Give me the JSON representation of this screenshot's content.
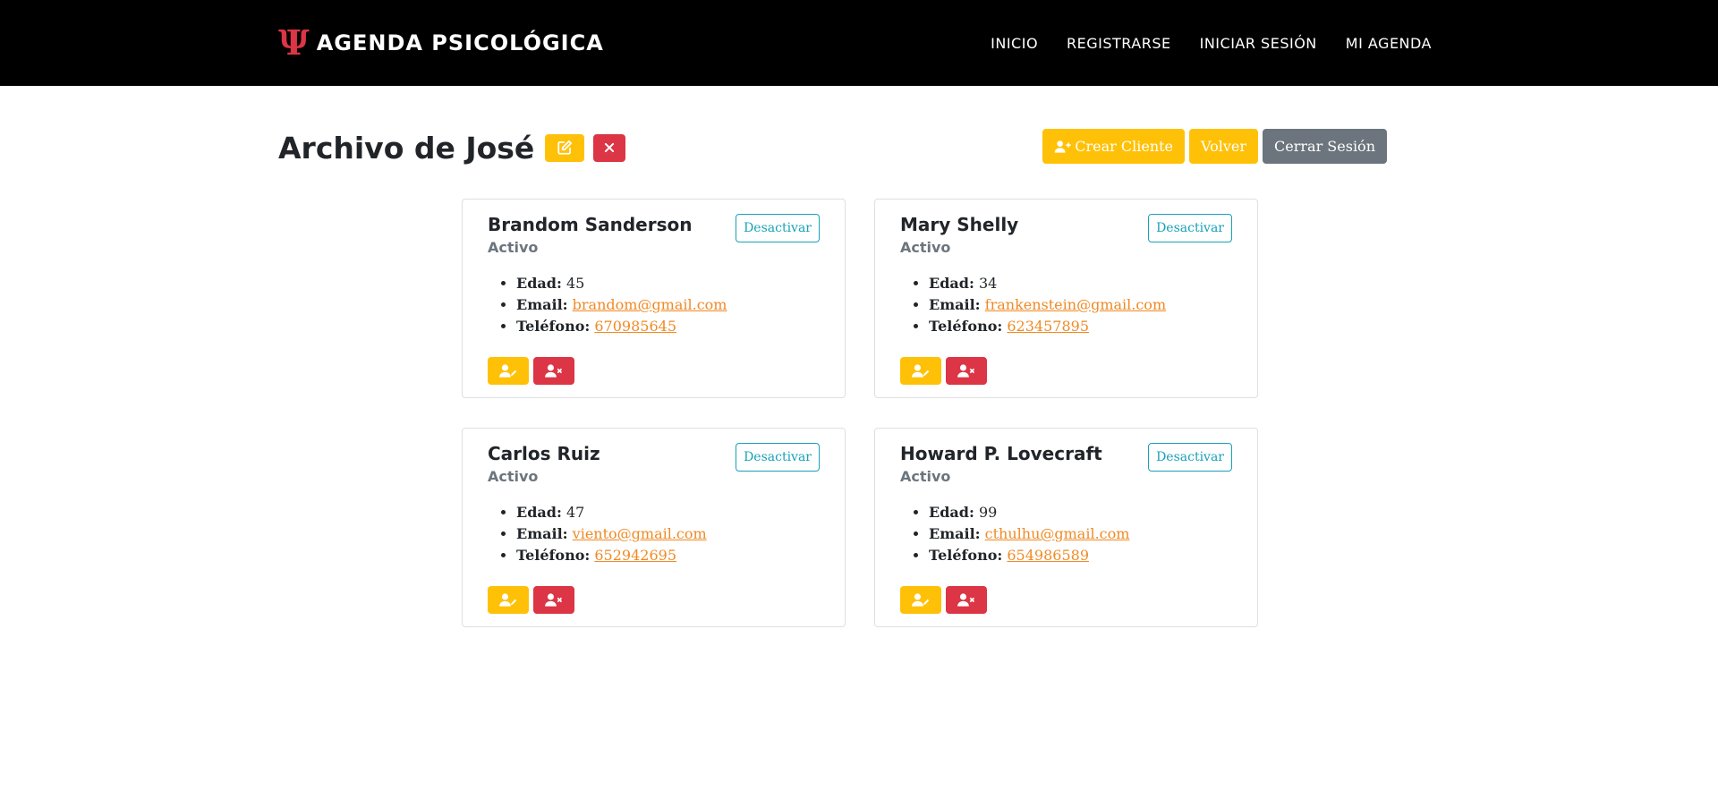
{
  "brand": {
    "icon": "Ψ",
    "name": "AGENDA PSICOLÓGICA"
  },
  "nav": [
    {
      "label": "INICIO"
    },
    {
      "label": "REGISTRARSE"
    },
    {
      "label": "INICIAR SESIÓN"
    },
    {
      "label": "MI AGENDA"
    }
  ],
  "page": {
    "title": "Archivo de José",
    "edit_icon": "edit-icon",
    "delete_icon": "close-icon"
  },
  "actions": {
    "create_client": "Crear Cliente",
    "back": "Volver",
    "logout": "Cerrar Sesión"
  },
  "labels": {
    "age": "Edad:",
    "email": "Email:",
    "phone": "Teléfono:",
    "deactivate": "Desactivar"
  },
  "clients": [
    {
      "name": "Brandom Sanderson",
      "status": "Activo",
      "age": "45",
      "email": "brandom@gmail.com",
      "phone": "670985645"
    },
    {
      "name": "Mary Shelly",
      "status": "Activo",
      "age": "34",
      "email": "frankenstein@gmail.com",
      "phone": "623457895"
    },
    {
      "name": "Carlos Ruiz",
      "status": "Activo",
      "age": "47",
      "email": "viento@gmail.com",
      "phone": "652942695"
    },
    {
      "name": "Howard P. Lovecraft",
      "status": "Activo",
      "age": "99",
      "email": "cthulhu@gmail.com",
      "phone": "654986589"
    }
  ],
  "colors": {
    "warning": "#ffc107",
    "danger": "#dc3545",
    "secondary": "#6c757d",
    "info": "#17a2b8",
    "link": "#f08a24"
  }
}
